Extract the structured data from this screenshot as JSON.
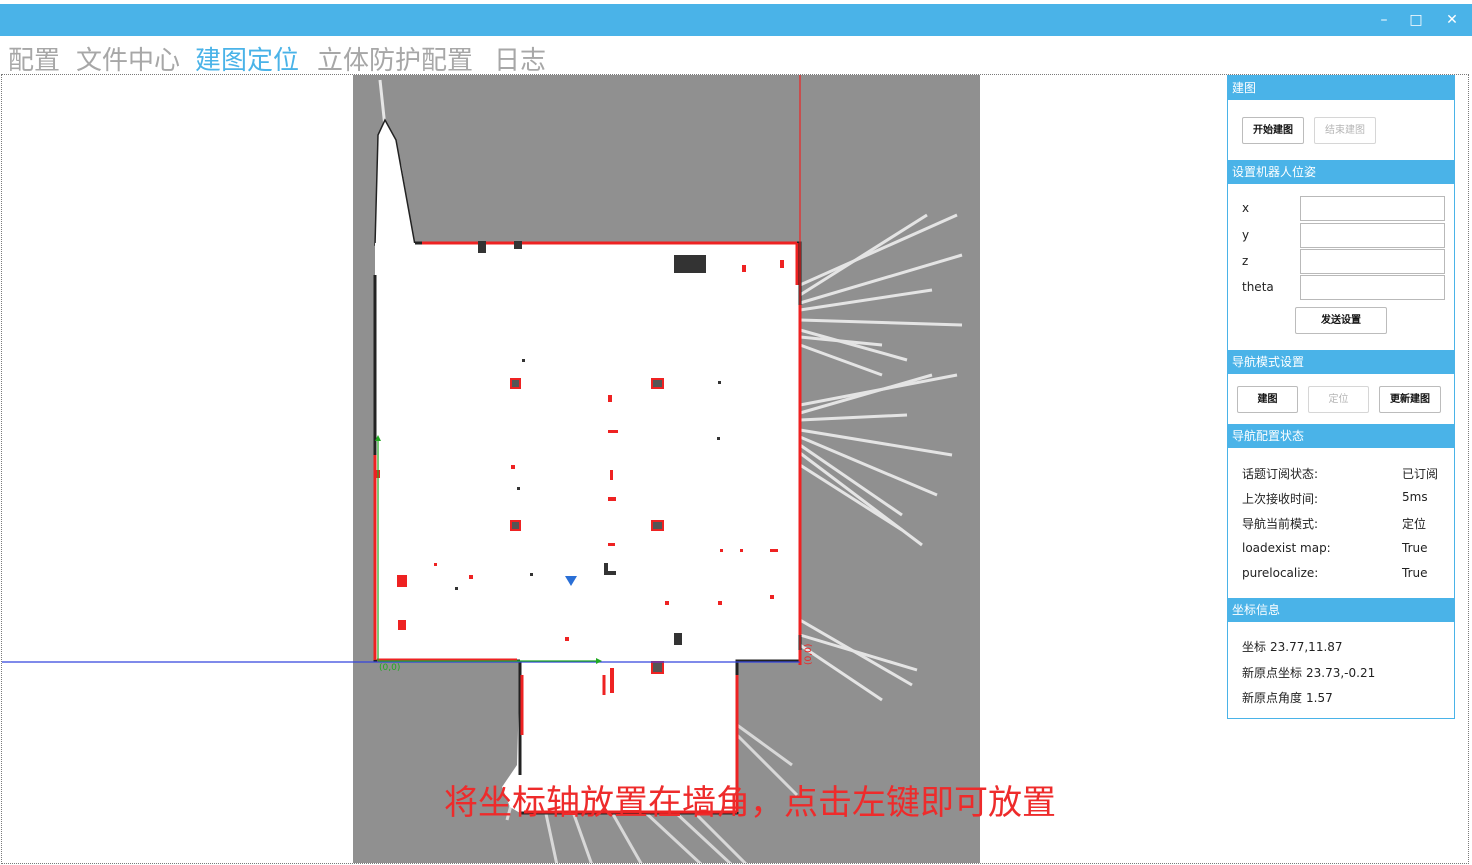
{
  "window": {
    "title": "",
    "minimize_glyph": "–",
    "maximize_glyph": "□",
    "close_glyph": "✕"
  },
  "menu": {
    "items": [
      "配置",
      "文件中心",
      "建图定位",
      "立体防护配置",
      "日志"
    ],
    "active_index": 2
  },
  "map": {
    "hint": "将坐标轴放置在墙角，点击左键即可放置",
    "origin_label_left": "(0,0)",
    "origin_label_right": "(0,0)"
  },
  "panel": {
    "mapping": {
      "header": "建图",
      "start_button": "开始建图",
      "end_button": "结束建图"
    },
    "pose": {
      "header": "设置机器人位姿",
      "fields": [
        {
          "label": "x",
          "value": ""
        },
        {
          "label": "y",
          "value": ""
        },
        {
          "label": "z",
          "value": ""
        },
        {
          "label": "theta",
          "value": ""
        }
      ],
      "send_button": "发送设置"
    },
    "nav_mode": {
      "header": "导航模式设置",
      "buttons": [
        "建图",
        "定位",
        "更新建图"
      ]
    },
    "nav_status": {
      "header": "导航配置状态",
      "rows": [
        {
          "label": "话题订阅状态:",
          "value": "已订阅"
        },
        {
          "label": "上次接收时间:",
          "value": "5ms"
        },
        {
          "label": "导航当前模式:",
          "value": "定位"
        },
        {
          "label": "loadexist map:",
          "value": "True"
        },
        {
          "label": "purelocalize:",
          "value": "True"
        }
      ]
    },
    "coord_info": {
      "header": "坐标信息",
      "rows": [
        {
          "label": "坐标",
          "value": "23.77,11.87"
        },
        {
          "label": "新原点坐标",
          "value": "23.73,-0.21"
        },
        {
          "label": "新原点角度",
          "value": "1.57"
        }
      ]
    }
  },
  "colors": {
    "accent": "#4ab3e8",
    "map_unknown": "#909090",
    "map_free": "#ffffff",
    "wall": "#222222",
    "laser": "#ee2222",
    "axis_x": "#3344dd",
    "axis_y": "#ee2222",
    "hint": "#ee2b2b"
  }
}
